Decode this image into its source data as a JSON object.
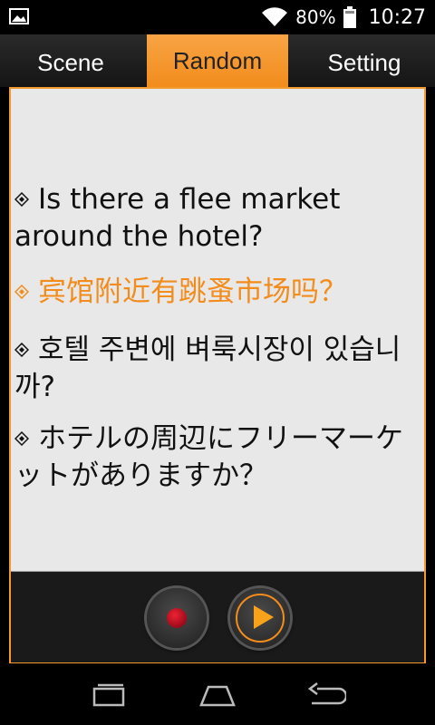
{
  "status": {
    "battery_percent": "80%",
    "time": "10:27",
    "icons": [
      "gallery-icon",
      "wifi-icon",
      "battery-icon"
    ]
  },
  "tabs": [
    {
      "label": "Scene"
    },
    {
      "label": "Random",
      "active": true
    },
    {
      "label": "Setting"
    }
  ],
  "phrases": {
    "english": "Is there a flee market around the hotel?",
    "chinese": "宾馆附近有跳蚤市场吗？",
    "korean": "호텔 주변에 벼룩시장이 있습니까?",
    "japanese": "ホテルの周辺にフリーマーケットがありますか？"
  },
  "controls": {
    "record_icon": "record-icon",
    "play_icon": "play-icon"
  },
  "nav": {
    "icons": [
      "recents-icon",
      "home-icon",
      "back-icon"
    ]
  },
  "colors": {
    "accent": "#f28c1c",
    "panel_bg": "#e8e8e8",
    "chinese_text": "#f28c1c"
  }
}
